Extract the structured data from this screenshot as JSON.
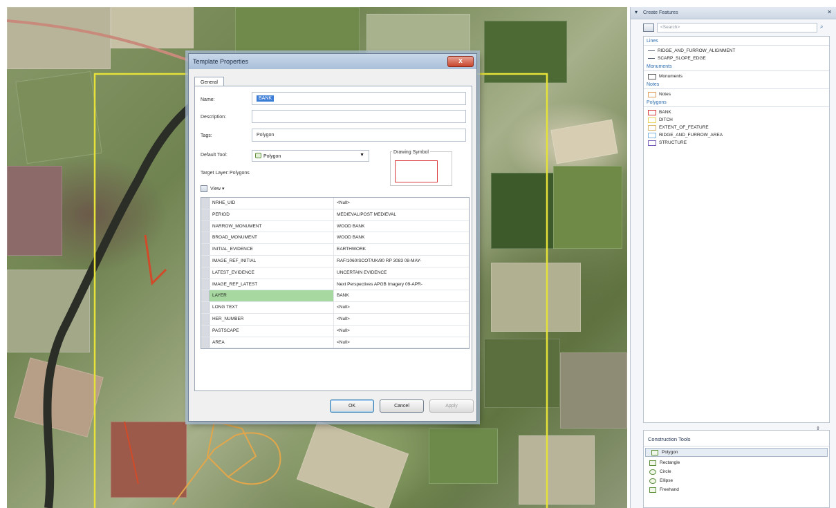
{
  "dialog": {
    "title": "Template Properties",
    "close": "x",
    "tab": "General",
    "name_label": "Name:",
    "name_value": "BANK",
    "description_label": "Description:",
    "description_value": "",
    "tags_label": "Tags:",
    "tags_value": "Polygon",
    "default_tool_label": "Default Tool:",
    "default_tool_value": "Polygon",
    "target_layer_label": "Target Layer:",
    "target_layer_value": "Polygons",
    "drawing_symbol_label": "Drawing Symbol",
    "view_label": "View ▾",
    "attributes": [
      {
        "key": "NRHE_UID",
        "value": "<Null>"
      },
      {
        "key": "PERIOD",
        "value": "MEDIEVAL/POST MEDIEVAL"
      },
      {
        "key": "NARROW_MONUMENT",
        "value": "WOOD BANK"
      },
      {
        "key": "BROAD_MONUMENT",
        "value": "WOOD BANK"
      },
      {
        "key": "INITIAL_EVIDENCE",
        "value": "EARTHWORK"
      },
      {
        "key": "IMAGE_REF_INITIAL",
        "value": "RAF/1060/SCOT/UK/80 RP 3083 08-MAY-"
      },
      {
        "key": "LATEST_EVIDENCE",
        "value": "UNCERTAIN EVIDENCE"
      },
      {
        "key": "IMAGE_REF_LATEST",
        "value": "Next Perspectives APGB Imagery 09-APR-"
      },
      {
        "key": "LAYER",
        "value": "BANK"
      },
      {
        "key": "LONG TEXT",
        "value": "<Null>"
      },
      {
        "key": "HER_NUMBER",
        "value": "<Null>"
      },
      {
        "key": "PASTSCAPE",
        "value": "<Null>"
      },
      {
        "key": "AREA",
        "value": "<Null>"
      }
    ],
    "ok": "OK",
    "cancel": "Cancel",
    "apply": "Apply"
  },
  "create_features": {
    "title": "Create Features",
    "search_placeholder": "<Search>",
    "groups": [
      {
        "name": "Lines",
        "items": [
          {
            "label": "RIDGE_AND_FURROW_ALIGNMENT",
            "kind": "line",
            "color": "#4a5a6a"
          },
          {
            "label": "SCARP_SLOPE_EDGE",
            "kind": "line",
            "color": "#4a5a6a"
          }
        ]
      },
      {
        "name": "Monuments",
        "items": [
          {
            "label": "Monuments",
            "kind": "poly",
            "color": "#5a5a5a"
          }
        ]
      },
      {
        "name": "Notes",
        "items": [
          {
            "label": "Notes",
            "kind": "poly",
            "color": "#e0a060"
          }
        ]
      },
      {
        "name": "Polygons",
        "items": [
          {
            "label": "BANK",
            "kind": "poly",
            "color": "#d9383a"
          },
          {
            "label": "DITCH",
            "kind": "poly",
            "color": "#e8d35a"
          },
          {
            "label": "EXTENT_OF_FEATURE",
            "kind": "poly",
            "color": "#d8b870"
          },
          {
            "label": "RIDGE_AND_FURROW_AREA",
            "kind": "poly",
            "color": "#7fb6e0"
          },
          {
            "label": "STRUCTURE",
            "kind": "poly",
            "color": "#7a5ab8"
          }
        ]
      }
    ],
    "construction_title": "Construction Tools",
    "tools": [
      "Polygon",
      "Rectangle",
      "Circle",
      "Ellipse",
      "Freehand"
    ]
  },
  "colors": {
    "map_overlay_yellow": "#e6e23a",
    "map_overlay_orange": "#e4a64a",
    "selection_green": "#a6d8a0"
  }
}
